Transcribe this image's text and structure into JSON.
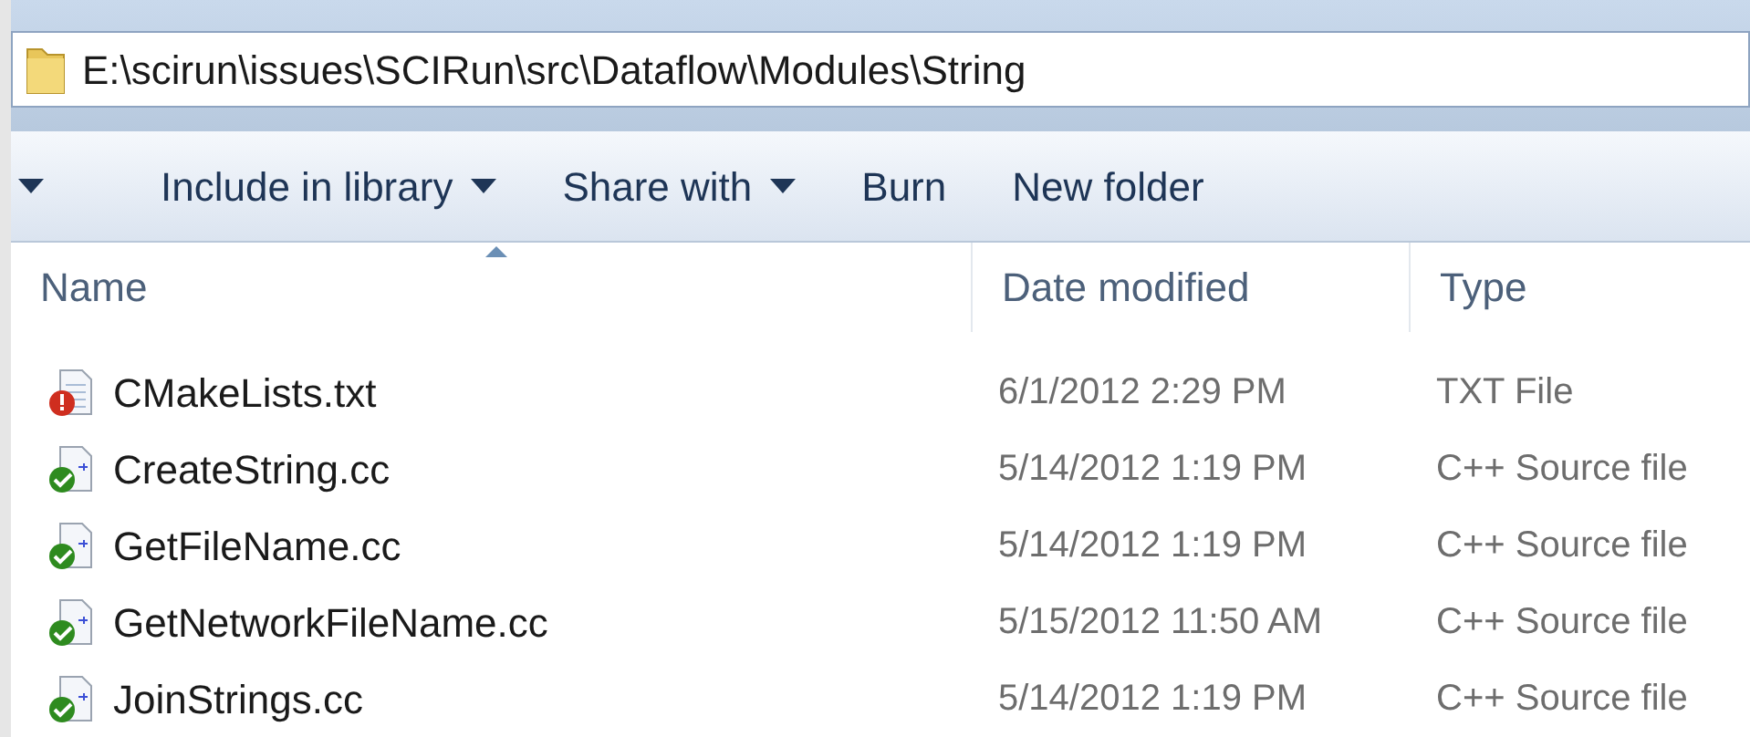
{
  "address_bar": {
    "path": "E:\\scirun\\issues\\SCIRun\\src\\Dataflow\\Modules\\String"
  },
  "toolbar": [
    {
      "label": "Include in library",
      "dropdown": true
    },
    {
      "label": "Share with",
      "dropdown": true
    },
    {
      "label": "Burn",
      "dropdown": false
    },
    {
      "label": "New folder",
      "dropdown": false
    }
  ],
  "columns": [
    {
      "label": "Name",
      "sorted": true
    },
    {
      "label": "Date modified",
      "sorted": false
    },
    {
      "label": "Type",
      "sorted": false
    }
  ],
  "rows": [
    {
      "name": "CMakeLists.txt",
      "date": "6/1/2012 2:29 PM",
      "type": "TXT File",
      "kind": "conflict"
    },
    {
      "name": "CreateString.cc",
      "date": "5/14/2012 1:19 PM",
      "type": "C++ Source file",
      "kind": "ok"
    },
    {
      "name": "GetFileName.cc",
      "date": "5/14/2012 1:19 PM",
      "type": "C++ Source file",
      "kind": "ok"
    },
    {
      "name": "GetNetworkFileName.cc",
      "date": "5/15/2012 11:50 AM",
      "type": "C++ Source file",
      "kind": "ok"
    },
    {
      "name": "JoinStrings.cc",
      "date": "5/14/2012 1:19 PM",
      "type": "C++ Source file",
      "kind": "ok"
    }
  ]
}
